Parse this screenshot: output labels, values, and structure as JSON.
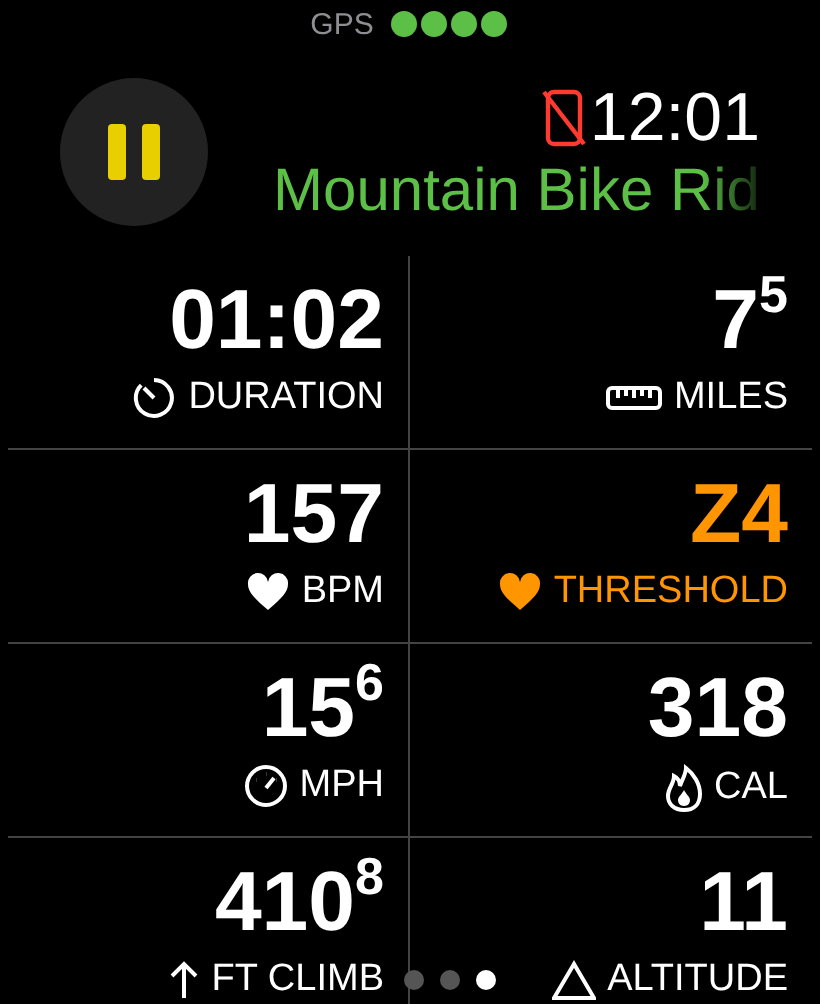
{
  "status": {
    "label": "GPS"
  },
  "header": {
    "time": "12:01",
    "title": "Mountain Bike Rid"
  },
  "metrics": [
    {
      "value": "01:02",
      "label": "DURATION",
      "kind": "timer",
      "color": "#ffffff"
    },
    {
      "value": "7$^{5}$",
      "label": "MILES",
      "kind": "ruler",
      "color": "#ffffff"
    },
    {
      "value": "157",
      "label": "BPM",
      "kind": "heart",
      "color": "#ffffff"
    },
    {
      "value": "Z4",
      "label": "THRESHOLD",
      "kind": "heart",
      "color": "#ff9500"
    },
    {
      "value": "15$^{6}$",
      "label": "MPH",
      "kind": "gauge",
      "color": "#ffffff"
    },
    {
      "value": "318",
      "label": "CAL",
      "kind": "flame",
      "color": "#ffffff"
    },
    {
      "value": "410$^{8}$",
      "label": "FT CLIMB",
      "kind": "arrow",
      "color": "#ffffff"
    },
    {
      "value": "11",
      "label": "ALTITUDE",
      "kind": "triangle",
      "color": "#ffffff"
    }
  ],
  "pages": [
    {
      "selected": false
    },
    {
      "selected": false
    },
    {
      "selected": true
    }
  ]
}
